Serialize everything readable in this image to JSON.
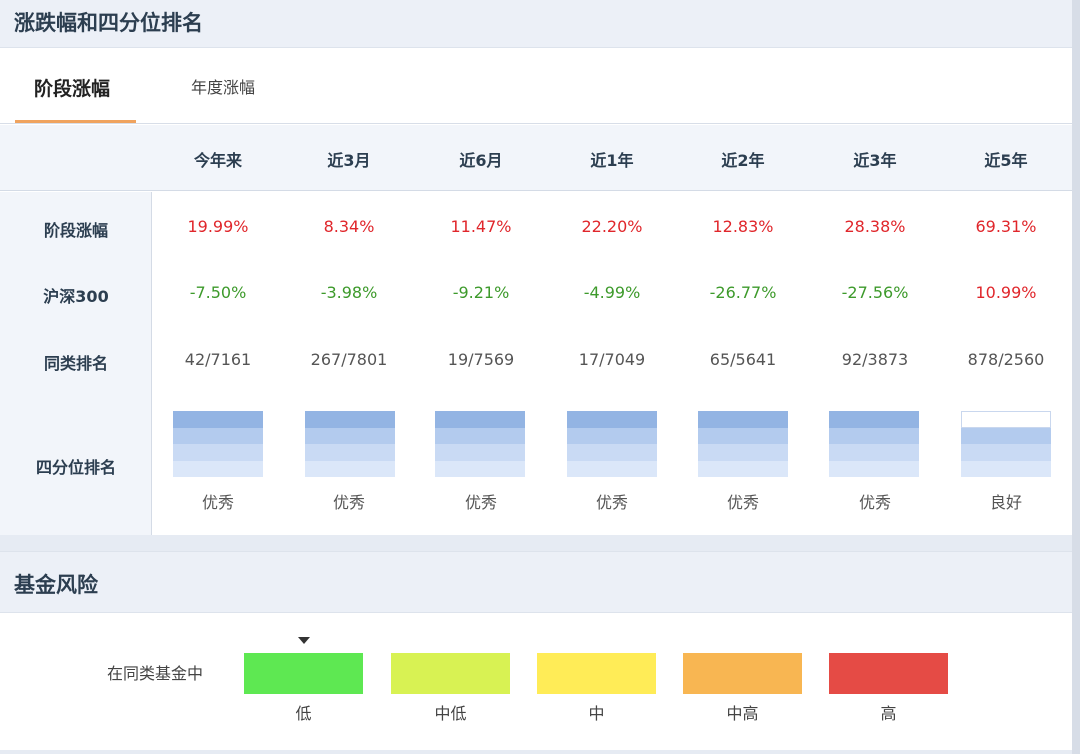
{
  "returns": {
    "title": "涨跌幅和四分位排名",
    "tabs": [
      {
        "label": "阶段涨幅",
        "active": true
      },
      {
        "label": "年度涨幅",
        "active": false
      }
    ],
    "columns": [
      "今年来",
      "近3月",
      "近6月",
      "近1年",
      "近2年",
      "近3年",
      "近5年"
    ],
    "rows": [
      {
        "label": "阶段涨幅",
        "values": [
          "19.99%",
          "8.34%",
          "11.47%",
          "22.20%",
          "12.83%",
          "28.38%",
          "69.31%"
        ],
        "tones": [
          "red",
          "red",
          "red",
          "red",
          "red",
          "red",
          "red"
        ]
      },
      {
        "label": "沪深300",
        "values": [
          "-7.50%",
          "-3.98%",
          "-9.21%",
          "-4.99%",
          "-26.77%",
          "-27.56%",
          "10.99%"
        ],
        "tones": [
          "green",
          "green",
          "green",
          "green",
          "green",
          "green",
          "red"
        ]
      },
      {
        "label": "同类排名",
        "values": [
          "42/7161",
          "267/7801",
          "19/7569",
          "17/7049",
          "65/5641",
          "92/3873",
          "878/2560"
        ],
        "tones": [
          "gray",
          "gray",
          "gray",
          "gray",
          "gray",
          "gray",
          "gray"
        ]
      }
    ],
    "quartile": {
      "label": "四分位排名",
      "ratings": [
        "优秀",
        "优秀",
        "优秀",
        "优秀",
        "优秀",
        "优秀",
        "良好"
      ],
      "levels": [
        4,
        4,
        4,
        4,
        4,
        4,
        3
      ]
    }
  },
  "risk": {
    "title": "基金风险",
    "label": "在同类基金中",
    "levels": [
      {
        "label": "低",
        "color": "#5ee852"
      },
      {
        "label": "中低",
        "color": "#d8f253"
      },
      {
        "label": "中",
        "color": "#ffec57"
      },
      {
        "label": "中高",
        "color": "#f8b652"
      },
      {
        "label": "高",
        "color": "#e54b45"
      }
    ],
    "current_level": "低"
  },
  "colors": {
    "up": "#e0262b",
    "down": "#3d9a2b",
    "accent": "#f0a35e"
  }
}
